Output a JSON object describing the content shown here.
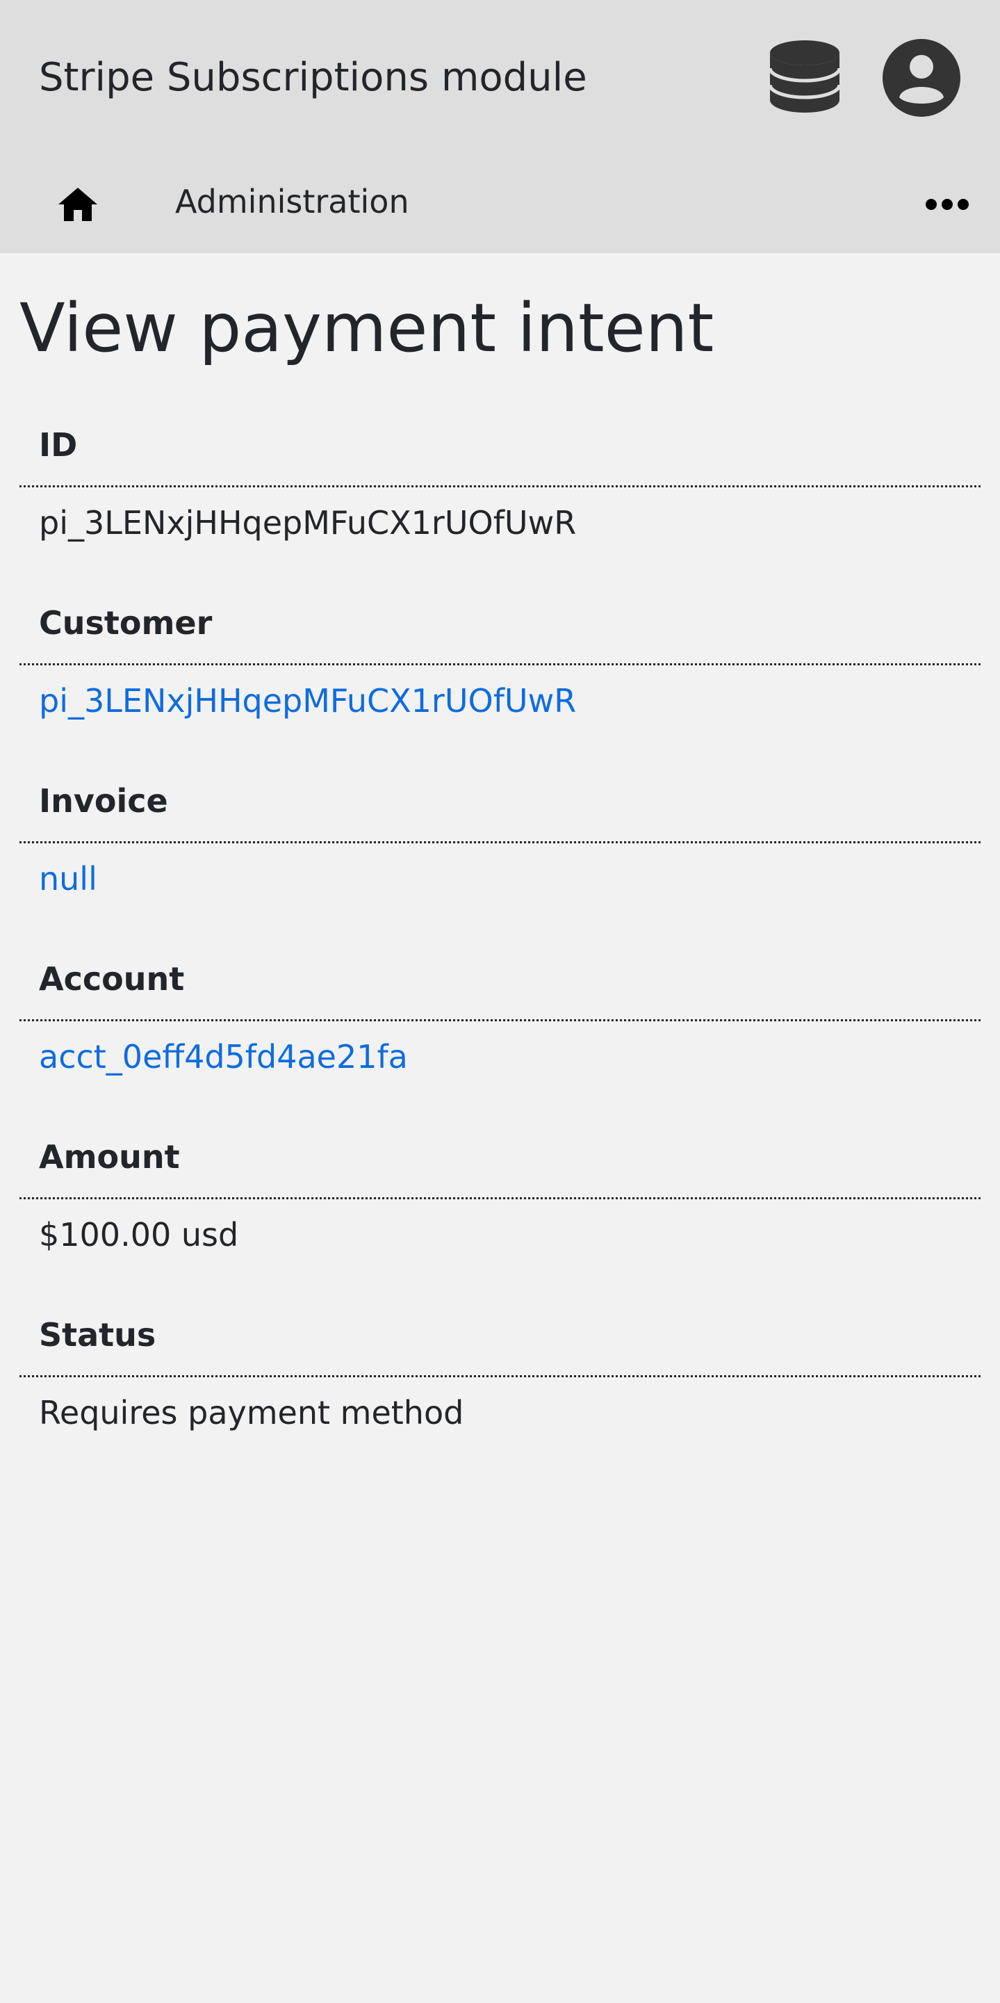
{
  "app": {
    "title": "Stripe Subscriptions module"
  },
  "header": {
    "icons": [
      "database-icon",
      "user-account-icon"
    ]
  },
  "nav": {
    "home_icon": "home-icon",
    "admin_label": "Administration",
    "more_icon": "more-horizontal-icon"
  },
  "page": {
    "title": "View payment intent"
  },
  "fields": {
    "id": {
      "label": "ID",
      "value": "pi_3LENxjHHqepMFuCX1rUOfUwR"
    },
    "customer": {
      "label": "Customer",
      "value": "pi_3LENxjHHqepMFuCX1rUOfUwR"
    },
    "invoice": {
      "label": "Invoice",
      "value": "null"
    },
    "account": {
      "label": "Account",
      "value": "acct_0eff4d5fd4ae21fa"
    },
    "amount": {
      "label": "Amount",
      "value": "$100.00 usd"
    },
    "status": {
      "label": "Status",
      "value": "Requires payment method"
    }
  },
  "colors": {
    "header_bg": "#dedede",
    "page_bg": "#f2f2f2",
    "text": "#222529",
    "link": "#0f6cde",
    "icon": "#343434"
  }
}
